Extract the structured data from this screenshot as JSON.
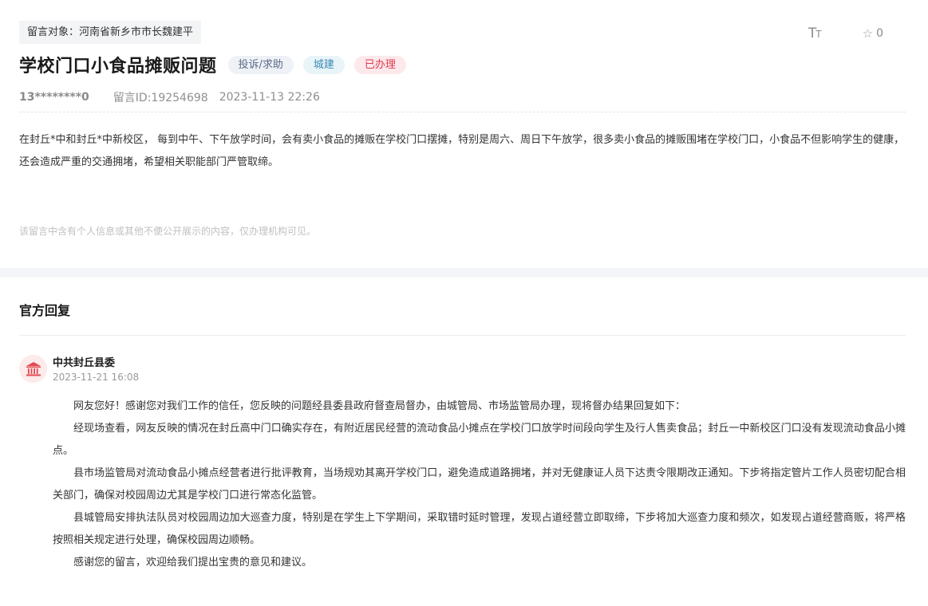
{
  "message": {
    "target": "留言对象：河南省新乡市市长魏建平",
    "title": "学校门口小食品摊贩问题",
    "tags": [
      "投诉/求助",
      "城建",
      "已办理"
    ],
    "user": "13********0",
    "message_id": "留言ID:19254698",
    "time": "2023-11-13 22:26",
    "content": "在封丘*中和封丘*中新校区， 每到中午、下午放学时间，会有卖小食品的摊贩在学校门口摆摊，特别是周六、周日下午放学，很多卖小食品的摊贩围堵在学校门口，小食品不但影响学生的健康，还会造成严重的交通拥堵，希望相关职能部门严管取缔。",
    "privacy_note": "该留言中含有个人信息或其他不便公开展示的内容，仅办理机构可见。"
  },
  "tools": {
    "font_icon": "font-size-icon",
    "font_big": "T",
    "font_small": "T",
    "star_icon": "star-outline-icon",
    "star_glyph": "☆",
    "favorite_count": "0"
  },
  "reply": {
    "heading": "官方回复",
    "org_icon": "government-building-icon",
    "org_name": "中共封丘县委",
    "time": "2023-11-21 16:08",
    "paragraphs": [
      "网友您好！感谢您对我们工作的信任，您反映的问题经县委县政府督查局督办，由城管局、市场监管局办理，现将督办结果回复如下：",
      "经现场查看，网友反映的情况在封丘高中门口确实存在，有附近居民经营的流动食品小摊点在学校门口放学时间段向学生及行人售卖食品；封丘一中新校区门口没有发现流动食品小摊点。",
      "县市场监管局对流动食品小摊点经营者进行批评教育，当场规劝其离开学校门口，避免造成道路拥堵，并对无健康证人员下达责令限期改正通知。下步将指定管片工作人员密切配合相关部门，确保对校园周边尤其是学校门口进行常态化监管。",
      "县城管局安排执法队员对校园周边加大巡查力度，特别是在学生上下学期间，采取错时延时管理，发现占道经营立即取缔，下步将加大巡查力度和频次，如发现占道经营商贩，将严格按照相关规定进行处理，确保校园周边顺畅。",
      "感谢您的留言，欢迎给我们提出宝贵的意见和建议。"
    ]
  },
  "colors": {
    "tag_complaint": "#5b6b86",
    "tag_city": "#3d8ab3",
    "tag_done": "#e03a4e",
    "section_gap": "#f3f5f8"
  }
}
